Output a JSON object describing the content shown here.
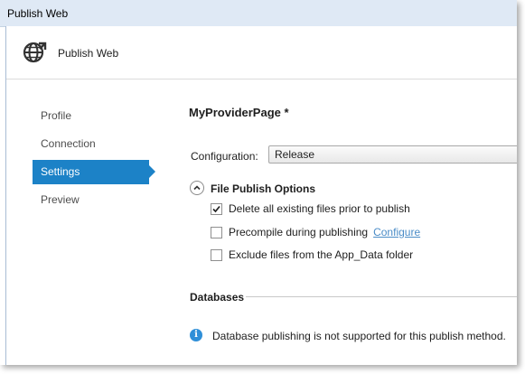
{
  "window": {
    "title": "Publish Web"
  },
  "header": {
    "title": "Publish Web",
    "icon": "globe-publish-icon"
  },
  "nav": {
    "items": [
      {
        "label": "Profile",
        "active": false
      },
      {
        "label": "Connection",
        "active": false
      },
      {
        "label": "Settings",
        "active": true
      },
      {
        "label": "Preview",
        "active": false
      }
    ]
  },
  "settings": {
    "page_title": "MyProviderPage *",
    "configuration_label": "Configuration:",
    "configuration_value": "Release",
    "file_publish_section": "File Publish Options",
    "options": [
      {
        "label": "Delete all existing files prior to publish",
        "checked": true
      },
      {
        "label": "Precompile during publishing",
        "checked": false,
        "link": "Configure"
      },
      {
        "label": "Exclude files from the App_Data folder",
        "checked": false
      }
    ],
    "databases_section": "Databases",
    "database_info": "Database publishing is not supported for this publish method."
  },
  "colors": {
    "accent": "#1c82c7",
    "link": "#4a8cc7",
    "info": "#2f8fd8"
  }
}
